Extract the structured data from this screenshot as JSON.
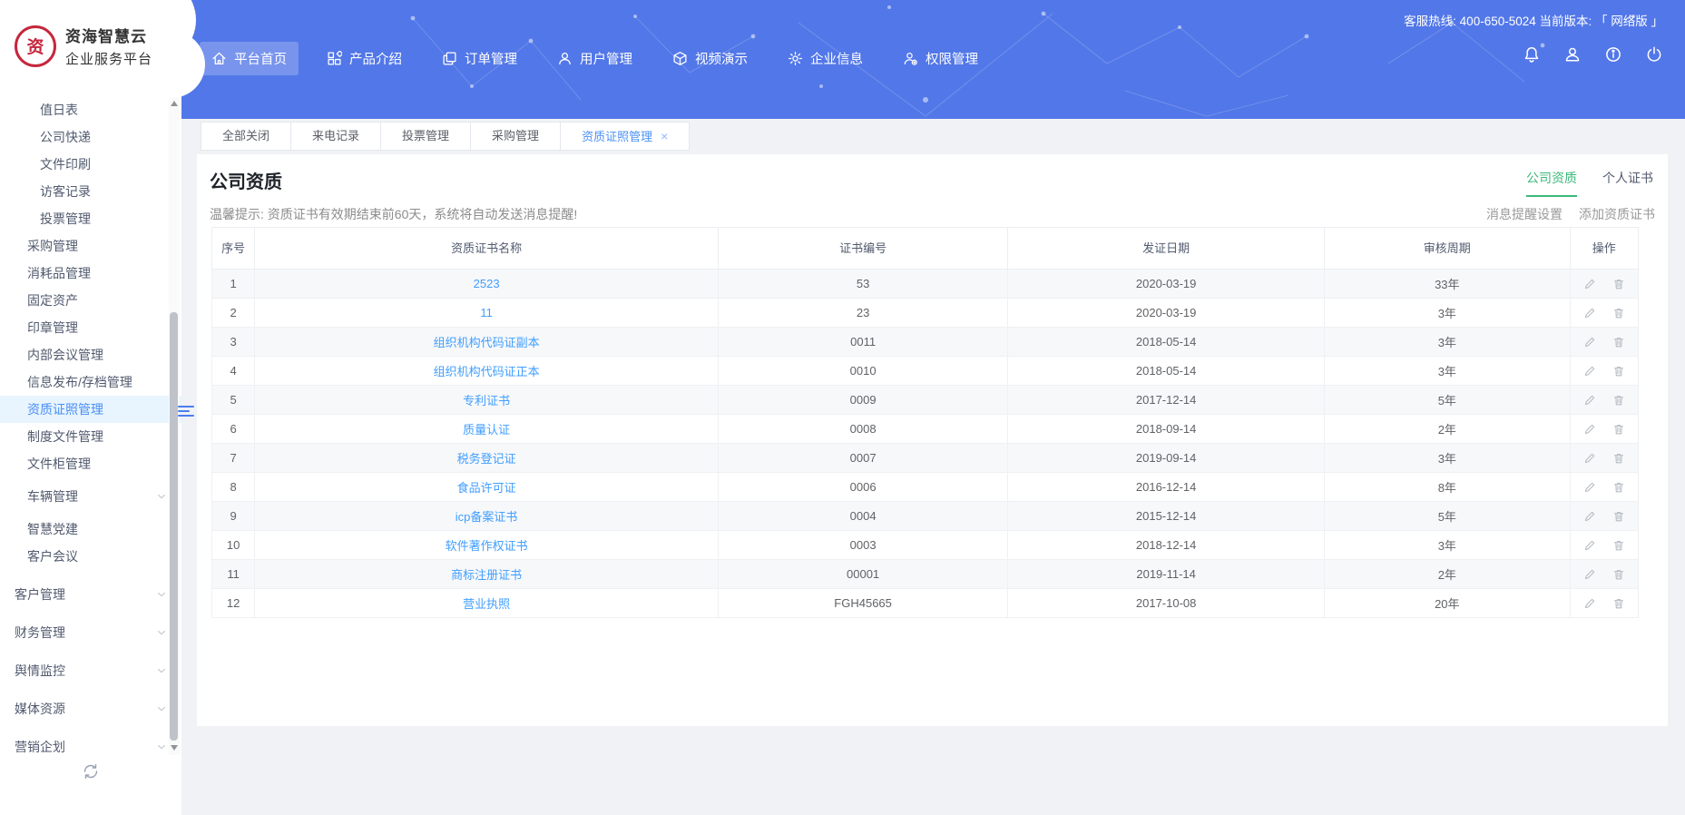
{
  "header": {
    "logo": {
      "title_line1": "资海智慧云",
      "title_line2": "企业服务平台",
      "badge_glyph": "资"
    },
    "hotline": "客服热线: 400-650-5024 当前版本: 「 网络版 」",
    "nav": [
      {
        "label": "平台首页",
        "icon": "home",
        "active": true
      },
      {
        "label": "产品介绍",
        "icon": "products",
        "active": false
      },
      {
        "label": "订单管理",
        "icon": "orders",
        "active": false
      },
      {
        "label": "用户管理",
        "icon": "users",
        "active": false
      },
      {
        "label": "视频演示",
        "icon": "video",
        "active": false
      },
      {
        "label": "企业信息",
        "icon": "company",
        "active": false
      },
      {
        "label": "权限管理",
        "icon": "permissions",
        "active": false
      }
    ],
    "action_icons": [
      "notification",
      "profile",
      "help",
      "logout"
    ]
  },
  "sidebar": {
    "items": [
      {
        "label": "值日表",
        "level": 2,
        "active": false,
        "has_children": false
      },
      {
        "label": "公司快递",
        "level": 2,
        "active": false,
        "has_children": false
      },
      {
        "label": "文件印刷",
        "level": 2,
        "active": false,
        "has_children": false
      },
      {
        "label": "访客记录",
        "level": 2,
        "active": false,
        "has_children": false
      },
      {
        "label": "投票管理",
        "level": 2,
        "active": false,
        "has_children": false
      },
      {
        "label": "采购管理",
        "level": 1,
        "active": false,
        "has_children": false
      },
      {
        "label": "消耗品管理",
        "level": 1,
        "active": false,
        "has_children": false
      },
      {
        "label": "固定资产",
        "level": 1,
        "active": false,
        "has_children": false
      },
      {
        "label": "印章管理",
        "level": 1,
        "active": false,
        "has_children": false
      },
      {
        "label": "内部会议管理",
        "level": 1,
        "active": false,
        "has_children": false
      },
      {
        "label": "信息发布/存档管理",
        "level": 1,
        "active": false,
        "has_children": false
      },
      {
        "label": "资质证照管理",
        "level": 1,
        "active": true,
        "has_children": false
      },
      {
        "label": "制度文件管理",
        "level": 1,
        "active": false,
        "has_children": false
      },
      {
        "label": "文件柜管理",
        "level": 1,
        "active": false,
        "has_children": false
      },
      {
        "label": "车辆管理",
        "level": 1,
        "active": false,
        "has_children": true
      },
      {
        "label": "智慧党建",
        "level": 1,
        "active": false,
        "has_children": false
      },
      {
        "label": "客户会议",
        "level": 1,
        "active": false,
        "has_children": false
      },
      {
        "label": "客户管理",
        "level": 0,
        "active": false,
        "has_children": true
      },
      {
        "label": "财务管理",
        "level": 0,
        "active": false,
        "has_children": true
      },
      {
        "label": "舆情监控",
        "level": 0,
        "active": false,
        "has_children": true
      },
      {
        "label": "媒体资源",
        "level": 0,
        "active": false,
        "has_children": true
      },
      {
        "label": "营销企划",
        "level": 0,
        "active": false,
        "has_children": true
      }
    ]
  },
  "tabbar": {
    "tabs": [
      {
        "label": "全部关闭",
        "active": false,
        "closable": false
      },
      {
        "label": "来电记录",
        "active": false,
        "closable": false
      },
      {
        "label": "投票管理",
        "active": false,
        "closable": false
      },
      {
        "label": "采购管理",
        "active": false,
        "closable": false
      },
      {
        "label": "资质证照管理",
        "active": true,
        "closable": true
      }
    ]
  },
  "content": {
    "title": "公司资质",
    "view_tabs": [
      {
        "label": "公司资质",
        "active": true
      },
      {
        "label": "个人证书",
        "active": false
      }
    ],
    "notice": "温馨提示: 资质证书有效期结束前60天，系统将自动发送消息提醒!",
    "toolbar_links": [
      "消息提醒设置",
      "添加资质证书"
    ],
    "table": {
      "columns": [
        "序号",
        "资质证书名称",
        "证书编号",
        "发证日期",
        "审核周期",
        "操作"
      ],
      "rows": [
        {
          "no": "1",
          "name": "2523",
          "code": "53",
          "date": "2020-03-19",
          "period": "33年"
        },
        {
          "no": "2",
          "name": "11",
          "code": "23",
          "date": "2020-03-19",
          "period": "3年"
        },
        {
          "no": "3",
          "name": "组织机构代码证副本",
          "code": "0011",
          "date": "2018-05-14",
          "period": "3年"
        },
        {
          "no": "4",
          "name": "组织机构代码证正本",
          "code": "0010",
          "date": "2018-05-14",
          "period": "3年"
        },
        {
          "no": "5",
          "name": "专利证书",
          "code": "0009",
          "date": "2017-12-14",
          "period": "5年"
        },
        {
          "no": "6",
          "name": "质量认证",
          "code": "0008",
          "date": "2018-09-14",
          "period": "2年"
        },
        {
          "no": "7",
          "name": "税务登记证",
          "code": "0007",
          "date": "2019-09-14",
          "period": "3年"
        },
        {
          "no": "8",
          "name": "食品许可证",
          "code": "0006",
          "date": "2016-12-14",
          "period": "8年"
        },
        {
          "no": "9",
          "name": "icp备案证书",
          "code": "0004",
          "date": "2015-12-14",
          "period": "5年"
        },
        {
          "no": "10",
          "name": "软件著作权证书",
          "code": "0003",
          "date": "2018-12-14",
          "period": "3年"
        },
        {
          "no": "11",
          "name": "商标注册证书",
          "code": "00001",
          "date": "2019-11-14",
          "period": "2年"
        },
        {
          "no": "12",
          "name": "营业执照",
          "code": "FGH45665",
          "date": "2017-10-08",
          "period": "20年"
        }
      ]
    }
  },
  "colors": {
    "header_blue": "#5277e8",
    "accent_green": "#3cb87a",
    "link_blue": "#409eff",
    "active_blue": "#4a8ff7"
  }
}
